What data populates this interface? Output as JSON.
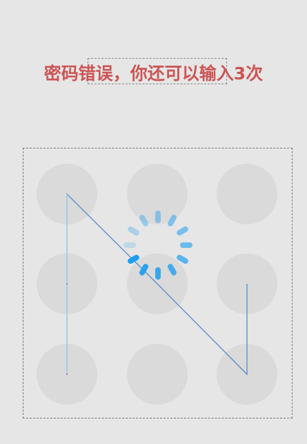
{
  "status": {
    "message": "密码错误，你还可以输入3次",
    "color": "#cc5555"
  },
  "pattern": {
    "grid_size": 3,
    "dot_count": 9,
    "line_color": "#5b8fcc",
    "dot_color": "#dadada",
    "drawn_sequence": [
      "dot-7",
      "dot-4",
      "dot-1",
      "dot-5",
      "dot-9",
      "dot-6"
    ]
  },
  "loading": {
    "icon": "spinner-icon",
    "color": "#1e9ef0"
  }
}
